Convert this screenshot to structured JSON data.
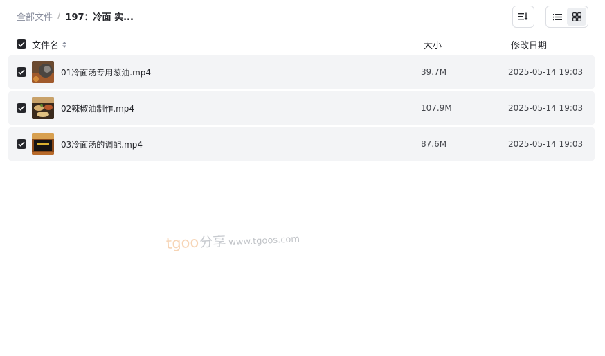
{
  "breadcrumb": {
    "root": "全部文件",
    "separator": "/",
    "current": "197：冷面 实..."
  },
  "toolbar": {
    "sort_icon": "sort-icon",
    "list_view_icon": "list-view-icon",
    "grid_view_icon": "grid-view-icon",
    "active_view": "list"
  },
  "columns": {
    "name": "文件名",
    "size": "大小",
    "modified": "修改日期"
  },
  "files": [
    {
      "name": "01冷面汤专用葱油.mp4",
      "size": "39.7M",
      "modified": "2025-05-14 19:03",
      "checked": true
    },
    {
      "name": "02辣椒油制作.mp4",
      "size": "107.9M",
      "modified": "2025-05-14 19:03",
      "checked": true
    },
    {
      "name": "03冷面汤的调配.mp4",
      "size": "87.6M",
      "modified": "2025-05-14 19:03",
      "checked": true
    }
  ],
  "watermark": {
    "brand_t": "tgoo",
    "brand_zh": "分享",
    "url": "www.tgoos.com"
  },
  "colors": {
    "checkbox": "#25262b",
    "row_bg": "#f3f4f6",
    "watermark_accent": "#f0b27a"
  }
}
